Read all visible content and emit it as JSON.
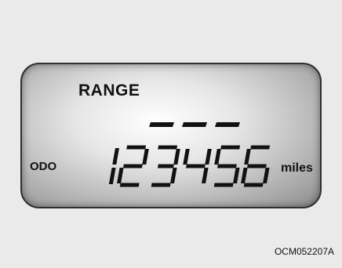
{
  "display": {
    "range_label": "RANGE",
    "range_value": "- - -",
    "odo_label": "ODO",
    "odometer_value": "123456",
    "unit_label": "miles"
  },
  "caption": "OCM052207A",
  "colors": {
    "lcd_text": "#111111",
    "lcd_background": "#e6e6e6",
    "page_background": "#eaeaea"
  }
}
